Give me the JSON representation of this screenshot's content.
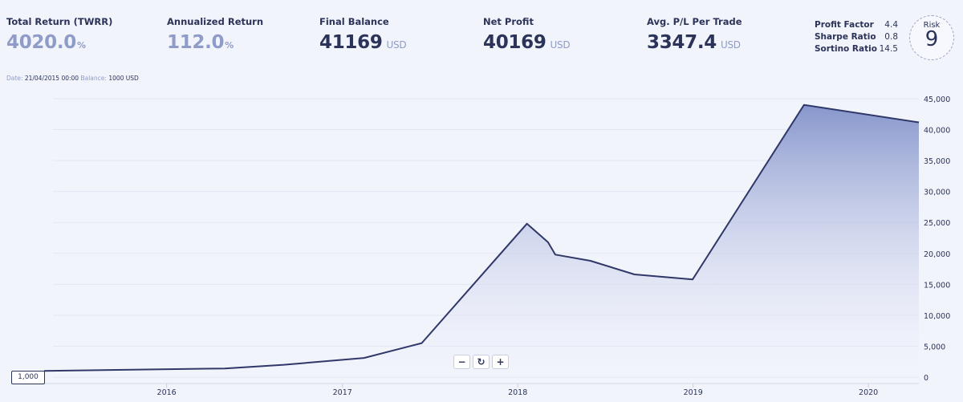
{
  "stats": [
    {
      "label": "Total Return (TWRR)",
      "value": "4020.0",
      "suffix": "%",
      "unit": ""
    },
    {
      "label": "Annualized Return",
      "value": "112.0",
      "suffix": "%",
      "unit": ""
    },
    {
      "label": "Final Balance",
      "value": "41169",
      "suffix": "",
      "unit": "USD"
    },
    {
      "label": "Net Profit",
      "value": "40169",
      "suffix": "",
      "unit": "USD"
    },
    {
      "label": "Avg. P/L Per Trade",
      "value": "3347.4",
      "suffix": "",
      "unit": "USD"
    }
  ],
  "ratios": [
    {
      "label": "Profit Factor",
      "value": "4.4"
    },
    {
      "label": "Sharpe Ratio",
      "value": "0.8"
    },
    {
      "label": "Sortino Ratio",
      "value": "14.5"
    }
  ],
  "risk": {
    "label": "Risk",
    "value": "9"
  },
  "tooltip": {
    "date_label": "Date:",
    "date_value": "21/04/2015 00:00",
    "balance_label": "Balance:",
    "balance_value": "1000 USD"
  },
  "start_flag": "1,000",
  "zoom": {
    "minus": "−",
    "reset": "↻",
    "plus": "+"
  },
  "colors": {
    "line": "#2f3868",
    "fill_top": "#8796cc",
    "fill_bottom": "#f2f4fc",
    "text": "#2b3358",
    "muted": "#8f9bc8"
  },
  "chart_data": {
    "type": "area",
    "title": "",
    "xlabel": "",
    "ylabel": "",
    "x_ticks": [
      "2016",
      "2017",
      "2018",
      "2019",
      "2020"
    ],
    "y_ticks": [
      "0",
      "5,000",
      "10,000",
      "15,000",
      "20,000",
      "25,000",
      "30,000",
      "35,000",
      "40,000",
      "45,000"
    ],
    "ylim": [
      0,
      45000
    ],
    "xlim": [
      "2015-04-21",
      "2020-04-15"
    ],
    "grid": true,
    "series": [
      {
        "points": [
          {
            "x": "2015-04-21",
            "y": 1000
          },
          {
            "x": "2016-05-01",
            "y": 1400
          },
          {
            "x": "2016-09-01",
            "y": 2000
          },
          {
            "x": "2017-02-15",
            "y": 3100
          },
          {
            "x": "2017-06-15",
            "y": 5500
          },
          {
            "x": "2018-01-20",
            "y": 24800
          },
          {
            "x": "2018-03-05",
            "y": 21800
          },
          {
            "x": "2018-03-20",
            "y": 19800
          },
          {
            "x": "2018-06-01",
            "y": 18800
          },
          {
            "x": "2018-09-01",
            "y": 16600
          },
          {
            "x": "2018-12-31",
            "y": 15800
          },
          {
            "x": "2019-08-20",
            "y": 44000
          },
          {
            "x": "2020-04-15",
            "y": 41169
          }
        ]
      }
    ]
  }
}
